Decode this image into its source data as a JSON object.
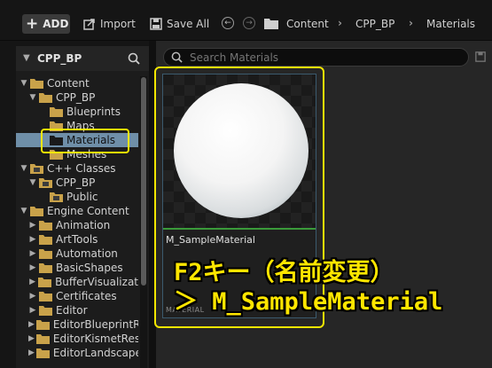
{
  "toolbar": {
    "add_label": "ADD",
    "import_label": "Import",
    "saveall_label": "Save All",
    "breadcrumbs": [
      "Content",
      "CPP_BP",
      "Materials"
    ]
  },
  "left_panel": {
    "title": "CPP_BP",
    "tree": [
      {
        "label": "Content",
        "expanded": true
      },
      {
        "label": "CPP_BP",
        "expanded": true
      },
      {
        "label": "Blueprints"
      },
      {
        "label": "Maps"
      },
      {
        "label": "Materials",
        "selected": true
      },
      {
        "label": "Meshes"
      },
      {
        "label": "C++ Classes",
        "expanded": true
      },
      {
        "label": "CPP_BP",
        "expanded": true
      },
      {
        "label": "Public"
      },
      {
        "label": "Engine Content",
        "expanded": true
      },
      {
        "label": "Animation"
      },
      {
        "label": "ArtTools"
      },
      {
        "label": "Automation"
      },
      {
        "label": "BasicShapes"
      },
      {
        "label": "BufferVisualizat"
      },
      {
        "label": "Certificates"
      },
      {
        "label": "Editor"
      },
      {
        "label": "EditorBlueprintR"
      },
      {
        "label": "EditorKismetRes"
      },
      {
        "label": "EditorLandscape"
      }
    ]
  },
  "search": {
    "placeholder": "Search Materials"
  },
  "asset": {
    "name": "M_SampleMaterial",
    "type": "MATERIAL"
  },
  "annotation": {
    "line1": "F2キー（名前変更）",
    "line2": "＞ M_SampleMaterial"
  },
  "colors": {
    "highlight": "#f2e600",
    "selection": "#6f8fa8",
    "folder": "#c9a24a"
  }
}
